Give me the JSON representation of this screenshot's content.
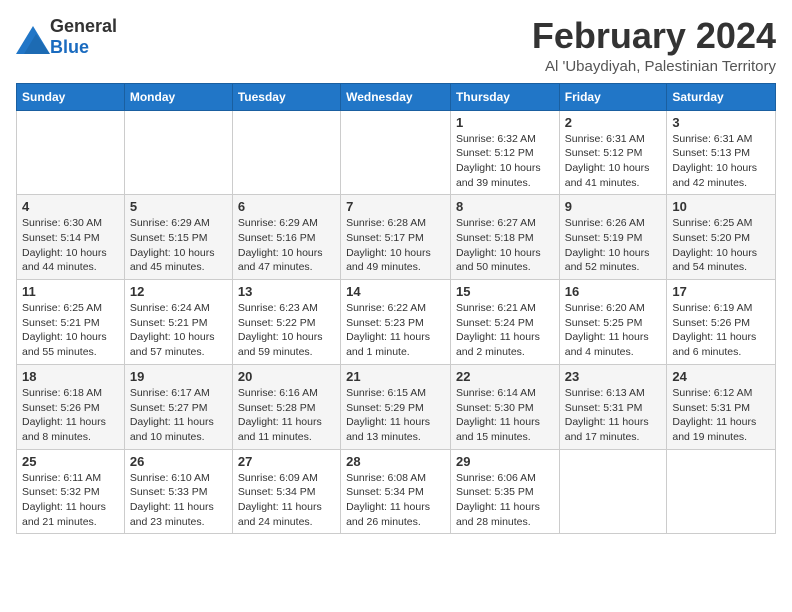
{
  "header": {
    "logo_general": "General",
    "logo_blue": "Blue",
    "month_title": "February 2024",
    "location": "Al 'Ubaydiyah, Palestinian Territory"
  },
  "weekdays": [
    "Sunday",
    "Monday",
    "Tuesday",
    "Wednesday",
    "Thursday",
    "Friday",
    "Saturday"
  ],
  "weeks": [
    [
      {
        "day": "",
        "info": ""
      },
      {
        "day": "",
        "info": ""
      },
      {
        "day": "",
        "info": ""
      },
      {
        "day": "",
        "info": ""
      },
      {
        "day": "1",
        "info": "Sunrise: 6:32 AM\nSunset: 5:12 PM\nDaylight: 10 hours\nand 39 minutes."
      },
      {
        "day": "2",
        "info": "Sunrise: 6:31 AM\nSunset: 5:12 PM\nDaylight: 10 hours\nand 41 minutes."
      },
      {
        "day": "3",
        "info": "Sunrise: 6:31 AM\nSunset: 5:13 PM\nDaylight: 10 hours\nand 42 minutes."
      }
    ],
    [
      {
        "day": "4",
        "info": "Sunrise: 6:30 AM\nSunset: 5:14 PM\nDaylight: 10 hours\nand 44 minutes."
      },
      {
        "day": "5",
        "info": "Sunrise: 6:29 AM\nSunset: 5:15 PM\nDaylight: 10 hours\nand 45 minutes."
      },
      {
        "day": "6",
        "info": "Sunrise: 6:29 AM\nSunset: 5:16 PM\nDaylight: 10 hours\nand 47 minutes."
      },
      {
        "day": "7",
        "info": "Sunrise: 6:28 AM\nSunset: 5:17 PM\nDaylight: 10 hours\nand 49 minutes."
      },
      {
        "day": "8",
        "info": "Sunrise: 6:27 AM\nSunset: 5:18 PM\nDaylight: 10 hours\nand 50 minutes."
      },
      {
        "day": "9",
        "info": "Sunrise: 6:26 AM\nSunset: 5:19 PM\nDaylight: 10 hours\nand 52 minutes."
      },
      {
        "day": "10",
        "info": "Sunrise: 6:25 AM\nSunset: 5:20 PM\nDaylight: 10 hours\nand 54 minutes."
      }
    ],
    [
      {
        "day": "11",
        "info": "Sunrise: 6:25 AM\nSunset: 5:21 PM\nDaylight: 10 hours\nand 55 minutes."
      },
      {
        "day": "12",
        "info": "Sunrise: 6:24 AM\nSunset: 5:21 PM\nDaylight: 10 hours\nand 57 minutes."
      },
      {
        "day": "13",
        "info": "Sunrise: 6:23 AM\nSunset: 5:22 PM\nDaylight: 10 hours\nand 59 minutes."
      },
      {
        "day": "14",
        "info": "Sunrise: 6:22 AM\nSunset: 5:23 PM\nDaylight: 11 hours\nand 1 minute."
      },
      {
        "day": "15",
        "info": "Sunrise: 6:21 AM\nSunset: 5:24 PM\nDaylight: 11 hours\nand 2 minutes."
      },
      {
        "day": "16",
        "info": "Sunrise: 6:20 AM\nSunset: 5:25 PM\nDaylight: 11 hours\nand 4 minutes."
      },
      {
        "day": "17",
        "info": "Sunrise: 6:19 AM\nSunset: 5:26 PM\nDaylight: 11 hours\nand 6 minutes."
      }
    ],
    [
      {
        "day": "18",
        "info": "Sunrise: 6:18 AM\nSunset: 5:26 PM\nDaylight: 11 hours\nand 8 minutes."
      },
      {
        "day": "19",
        "info": "Sunrise: 6:17 AM\nSunset: 5:27 PM\nDaylight: 11 hours\nand 10 minutes."
      },
      {
        "day": "20",
        "info": "Sunrise: 6:16 AM\nSunset: 5:28 PM\nDaylight: 11 hours\nand 11 minutes."
      },
      {
        "day": "21",
        "info": "Sunrise: 6:15 AM\nSunset: 5:29 PM\nDaylight: 11 hours\nand 13 minutes."
      },
      {
        "day": "22",
        "info": "Sunrise: 6:14 AM\nSunset: 5:30 PM\nDaylight: 11 hours\nand 15 minutes."
      },
      {
        "day": "23",
        "info": "Sunrise: 6:13 AM\nSunset: 5:31 PM\nDaylight: 11 hours\nand 17 minutes."
      },
      {
        "day": "24",
        "info": "Sunrise: 6:12 AM\nSunset: 5:31 PM\nDaylight: 11 hours\nand 19 minutes."
      }
    ],
    [
      {
        "day": "25",
        "info": "Sunrise: 6:11 AM\nSunset: 5:32 PM\nDaylight: 11 hours\nand 21 minutes."
      },
      {
        "day": "26",
        "info": "Sunrise: 6:10 AM\nSunset: 5:33 PM\nDaylight: 11 hours\nand 23 minutes."
      },
      {
        "day": "27",
        "info": "Sunrise: 6:09 AM\nSunset: 5:34 PM\nDaylight: 11 hours\nand 24 minutes."
      },
      {
        "day": "28",
        "info": "Sunrise: 6:08 AM\nSunset: 5:34 PM\nDaylight: 11 hours\nand 26 minutes."
      },
      {
        "day": "29",
        "info": "Sunrise: 6:06 AM\nSunset: 5:35 PM\nDaylight: 11 hours\nand 28 minutes."
      },
      {
        "day": "",
        "info": ""
      },
      {
        "day": "",
        "info": ""
      }
    ]
  ]
}
